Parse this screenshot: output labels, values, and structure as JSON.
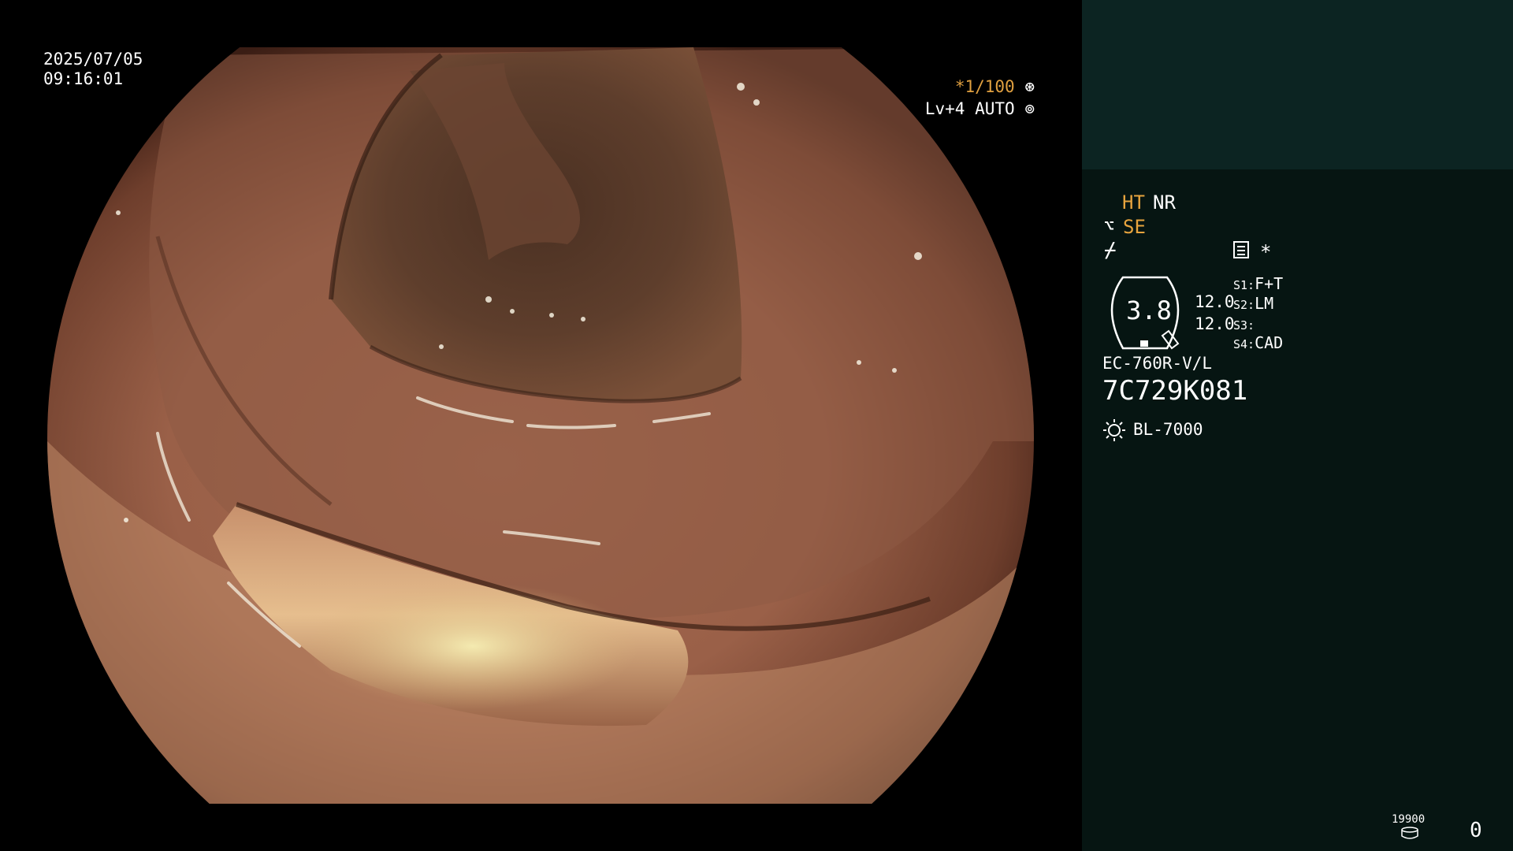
{
  "overlay": {
    "date": "2025/07/05",
    "time": "09:16:01",
    "shutter": "*1/100",
    "shutter_icon": "aperture-icon",
    "level": "Lv+4",
    "auto": "AUTO",
    "auto_icon": "iris-icon"
  },
  "panel": {
    "ht": "HT",
    "nr": "NR",
    "se": "SE",
    "se_icon": "structure-enhance-icon",
    "status_icon": "freeze-off-icon",
    "mode_icon": "menu-list-icon",
    "star": "*",
    "gauge_value": "3.8",
    "value1": "12.0",
    "value2": "12.0",
    "switches": [
      {
        "key": "S1:",
        "value": "F+T"
      },
      {
        "key": "S2:",
        "value": "LM"
      },
      {
        "key": "S3:",
        "value": ""
      },
      {
        "key": "S4:",
        "value": "CAD"
      }
    ],
    "scope_model": "EC-760R-V/L",
    "scope_serial": "7C729K081",
    "light_icon": "light-source-icon",
    "light_source": "BL-7000",
    "counter_small": "19900",
    "counter_icon": "disk-icon",
    "counter_main": "0"
  },
  "colors": {
    "panel_bg": "#061512",
    "panel_top_bg": "#0c2422",
    "amber": "#e7a43e"
  }
}
